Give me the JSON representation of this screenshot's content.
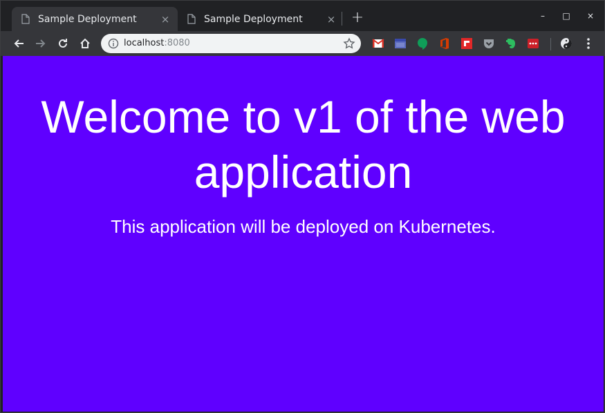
{
  "browser": {
    "tabs": [
      {
        "title": "Sample Deployment",
        "active": true
      },
      {
        "title": "Sample Deployment",
        "active": false
      }
    ],
    "new_tab_symbol": "+",
    "close_symbol": "×",
    "window_controls": {
      "minimize": "–",
      "maximize": "□",
      "close": "×"
    },
    "address": {
      "host": "localhost",
      "port": ":8080"
    },
    "extensions": [
      {
        "name": "gmail-icon",
        "color": "#d93025"
      },
      {
        "name": "google-calendar-icon",
        "color": "#5c6bc0"
      },
      {
        "name": "hangouts-icon",
        "color": "#0f9d58"
      },
      {
        "name": "office-icon",
        "color": "#d83b01"
      },
      {
        "name": "flipboard-icon",
        "color": "#e12828"
      },
      {
        "name": "pocket-icon",
        "color": "#9aa0a6"
      },
      {
        "name": "evernote-icon",
        "color": "#2dbe60"
      },
      {
        "name": "lastpass-icon",
        "color": "#cc2029"
      },
      {
        "name": "yin-yang-icon",
        "color": "#e8eaed"
      }
    ]
  },
  "page": {
    "heading": "Welcome to v1 of the web application",
    "subtitle": "This application will be deployed on Kubernetes.",
    "background_color": "#5f00ff"
  }
}
